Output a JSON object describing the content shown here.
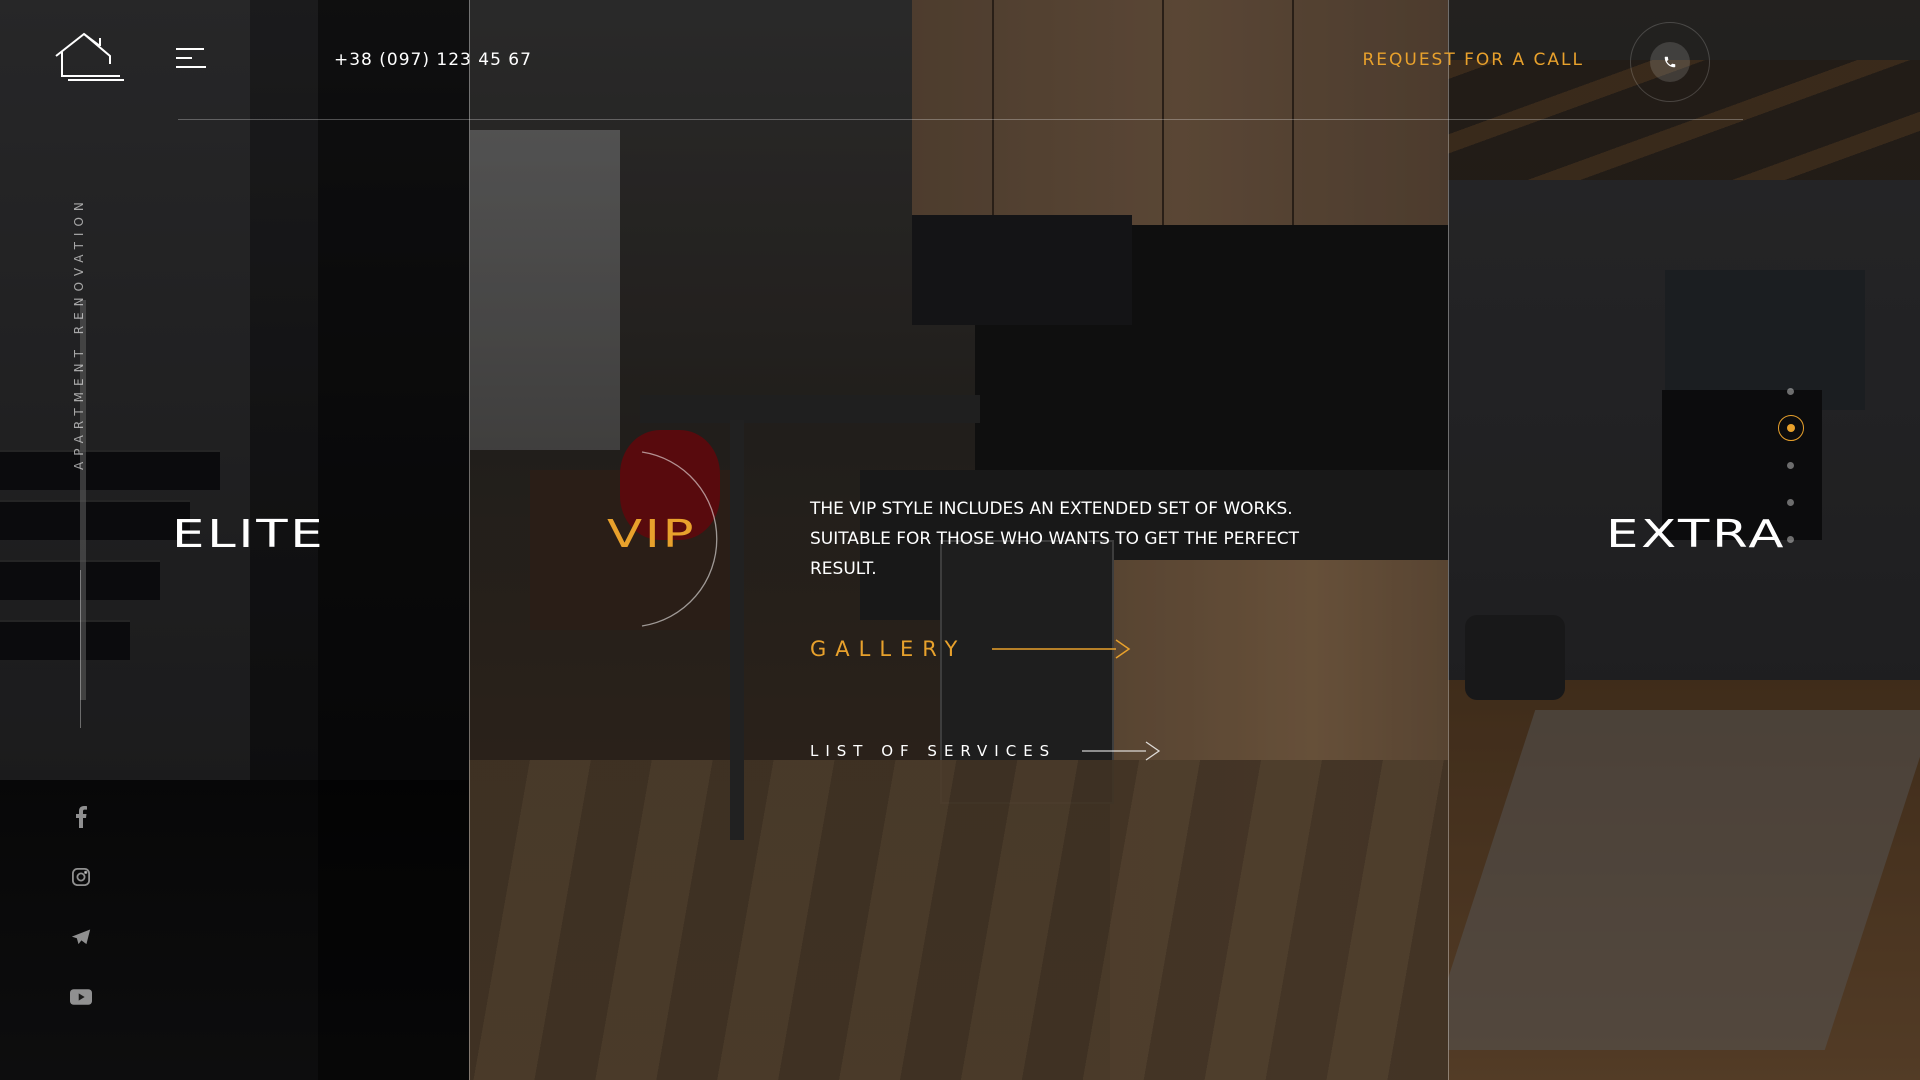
{
  "header": {
    "phone": "+38 (097) 123 45 67",
    "request_call_label": "REQUEST FOR A CALL"
  },
  "sidebar": {
    "vertical_text": "APARTMENT RENOVATION",
    "socials": [
      {
        "icon": "facebook-icon"
      },
      {
        "icon": "instagram-icon"
      },
      {
        "icon": "telegram-icon"
      },
      {
        "icon": "youtube-icon"
      }
    ]
  },
  "categories": {
    "elite": "ELITE",
    "vip": "VIP",
    "extra": "EXTRA"
  },
  "main": {
    "description": "THE VIP STYLE INCLUDES AN EXTENDED SET OF WORKS. SUITABLE FOR THOSE WHO WANTS TO GET THE PERFECT RESULT.",
    "gallery_label": "GALLERY",
    "services_label": "LIST OF SERVICES"
  },
  "slider": {
    "total_dots": 5,
    "active_index": 1
  },
  "colors": {
    "accent": "#e8a12c",
    "text": "#ffffff"
  }
}
